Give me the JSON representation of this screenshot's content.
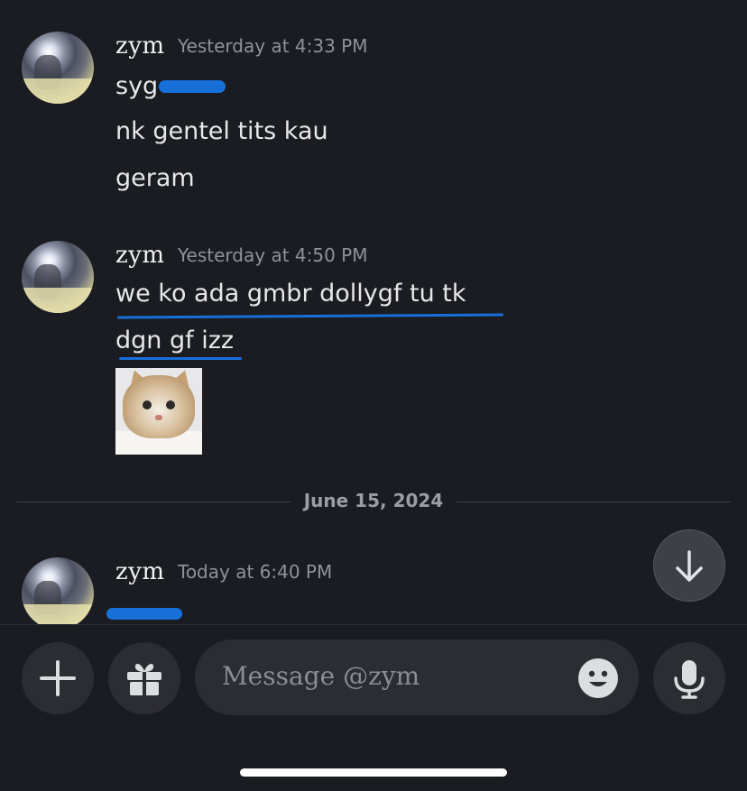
{
  "conversation": {
    "groups": [
      {
        "username": "zym",
        "timestamp": "Yesterday at 4:33 PM",
        "lines": [
          "syg",
          "nk gentel tits kau",
          "geram"
        ]
      },
      {
        "username": "zym",
        "timestamp": "Yesterday at 4:50 PM",
        "lines": [
          "we ko ada gmbr dollygf tu tk",
          "dgn gf izz"
        ],
        "attachment": "cat-image"
      },
      {
        "username": "zym",
        "timestamp": "Today at 6:40 PM",
        "lines": []
      }
    ],
    "date_divider": "June 15, 2024"
  },
  "composer": {
    "placeholder": "Message @zym",
    "icons": {
      "add": "plus-icon",
      "gift": "gift-icon",
      "emoji": "emoji-icon",
      "mic": "microphone-icon",
      "jump": "arrow-down-icon"
    }
  },
  "colors": {
    "background": "#1b1c21",
    "input_bg": "#2c2d33",
    "annotation_blue": "#1670d8",
    "timestamp": "#8f929b"
  }
}
